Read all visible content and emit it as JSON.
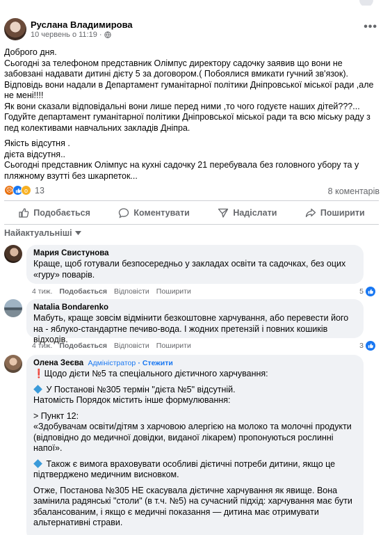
{
  "post": {
    "author": "Руслана Владимирова",
    "date": "10 червень о 11:19",
    "separator": "·",
    "body": [
      "Доброго дня.\nСьогодні за телефоном представник Олімпус директору садочку заявив що вони не забовзані надавати дитині дієту 5 за договором.( Побоялися вмикати гучний зв'язок).\nВідповідь вони надали в Департамент гуманітарної політики Дніпровської міської ради ,але не мені!!!!\nЯк вони сказали відповідальні вони лише перед ними ,то чого годуєте наших дітей???...\nГодуйте департамент гуманітарної політики Дніпровської міської ради та всю міську раду з пед колективами навчальних закладів Дніпра.",
      "Якість відсутня .\nдієта відсутня..\nСьогодні представник Олімпус на кухні садочку 21 перебувала без головного убору та у пляжному взутті без шкарпеток..."
    ],
    "reaction_count": "13",
    "comments_count": "8 коментарів"
  },
  "actions": {
    "like": "Подобається",
    "comment": "Коментувати",
    "send": "Надіслати",
    "share": "Поширити"
  },
  "sort_label": "Найактуальніші",
  "comments": [
    {
      "name": "Мария Свистунова",
      "text": "Краще, щоб готували безпосередньо у закладах освіти та садочках, без оцих «гуру» поварів.",
      "time": "4 тиж.",
      "like": "Подобається",
      "reply": "Відповісти",
      "share": "Поширити",
      "reactions": "5"
    },
    {
      "name": "Natalia Bondarenko",
      "text": "Мабуть, краще зовсім відмінити безкоштовне харчування, або перевести його на - яблуко-стандартне печиво-вода. І жодних претензій і повних кошиків відходів.",
      "time": "4 тиж.",
      "like": "Подобається",
      "reply": "Відповісти",
      "share": "Поширити",
      "reactions": "3"
    },
    {
      "name": "Олена Зеєва",
      "role": "Адміністратор",
      "follow": "· Стежити",
      "lines": {
        "l1": "Щодо дієти №5 та спеціального дієтичного харчування:",
        "l2": "У Постанові №305 термін \"дієта №5\" відсутній.",
        "l3": "Натомість Порядок містить інше формулювання:",
        "l4": "> Пункт 12:",
        "l5": "«Здобувачам освіти/дітям з харчовою алергією на молоко та молочні продукти (відповідно до медичної довідки, виданої лікарем) пропонуються рослинні напої».",
        "l6": "Також є вимога враховувати особливі дієтичні потреби дитини, якщо це підтверджено медичним висновком.",
        "l7": "Отже, Постанова №305 НЕ скасувала дієтичне харчування як явище. Вона замінила радянські \"столи\" (в т.ч. №5) на сучасний підхід: харчування має бути збалансованим, і якщо є медичні показання — дитина має отримувати альтернативні страви.",
        "l8": "---"
      }
    }
  ]
}
